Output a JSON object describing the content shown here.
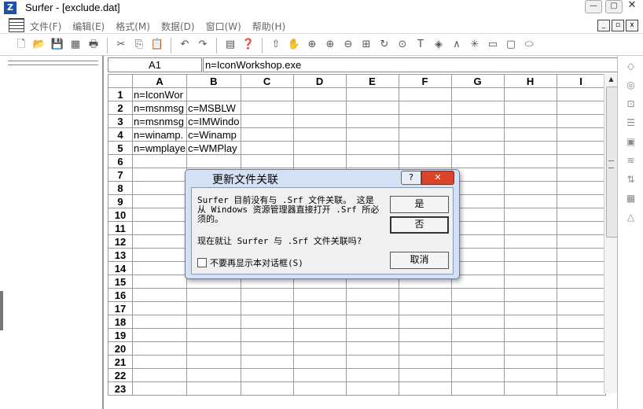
{
  "window": {
    "title": "Surfer - [exclude.dat]",
    "app_icon": "Z",
    "controls": [
      "—",
      "▢",
      "✕"
    ]
  },
  "menubar": {
    "items": [
      "文件(F)",
      "编辑(E)",
      "格式(M)",
      "数据(D)",
      "窗口(W)",
      "帮助(H)"
    ],
    "mdi_controls": [
      "_",
      "▫",
      "x"
    ]
  },
  "toolbar": {
    "icons": [
      "new-file-icon",
      "open-folder-icon",
      "save-icon",
      "worksheet-icon",
      "print-icon",
      "cut-icon",
      "copy-icon",
      "paste-icon",
      "undo-icon",
      "redo-icon",
      "object-manager-icon",
      "whats-this-icon",
      "select-arrow-icon",
      "pan-hand-icon",
      "zoom-rect-icon",
      "zoom-in-icon",
      "zoom-out-icon",
      "zoom-page-icon",
      "redraw-icon",
      "digitize-icon",
      "text-icon",
      "polygon-icon",
      "polyline-icon",
      "symbol-icon",
      "rectangle-icon",
      "rounded-rect-icon",
      "ellipse-icon"
    ],
    "glyphs": [
      "🗋",
      "📂",
      "💾",
      "▦",
      "🖶",
      "✂",
      "⎘",
      "📋",
      "↶",
      "↷",
      "▤",
      "❓",
      "⇧",
      "✋",
      "⊕",
      "⊕",
      "⊖",
      "⊞",
      "↻",
      "⊙",
      "T",
      "◈",
      "∧",
      "✳",
      "▭",
      "▢",
      "⬭"
    ]
  },
  "formula_bar": {
    "cell_ref": "A1",
    "value": "n=IconWorkshop.exe"
  },
  "sheet": {
    "columns": [
      "A",
      "B",
      "C",
      "D",
      "E",
      "F",
      "G",
      "H",
      "I"
    ],
    "rows": [
      {
        "num": "1",
        "cells": [
          "n=IconWor",
          "",
          "",
          "",
          "",
          "",
          "",
          "",
          ""
        ]
      },
      {
        "num": "2",
        "cells": [
          "n=msnmsg",
          "c=MSBLW",
          "",
          "",
          "",
          "",
          "",
          "",
          ""
        ]
      },
      {
        "num": "3",
        "cells": [
          "n=msnmsg",
          "c=IMWindo",
          "",
          "",
          "",
          "",
          "",
          "",
          ""
        ]
      },
      {
        "num": "4",
        "cells": [
          "n=winamp.",
          "c=Winamp",
          "",
          "",
          "",
          "",
          "",
          "",
          ""
        ]
      },
      {
        "num": "5",
        "cells": [
          "n=wmplaye",
          "c=WMPlay",
          "",
          "",
          "",
          "",
          "",
          "",
          ""
        ]
      },
      {
        "num": "6",
        "cells": [
          "",
          "",
          "",
          "",
          "",
          "",
          "",
          "",
          ""
        ]
      },
      {
        "num": "7",
        "cells": [
          "",
          "",
          "",
          "",
          "",
          "",
          "",
          "",
          ""
        ]
      },
      {
        "num": "8",
        "cells": [
          "",
          "",
          "",
          "",
          "",
          "",
          "",
          "",
          ""
        ]
      },
      {
        "num": "9",
        "cells": [
          "",
          "",
          "",
          "",
          "",
          "",
          "",
          "",
          ""
        ]
      },
      {
        "num": "10",
        "cells": [
          "",
          "",
          "",
          "",
          "",
          "",
          "",
          "",
          ""
        ]
      },
      {
        "num": "11",
        "cells": [
          "",
          "",
          "",
          "",
          "",
          "",
          "",
          "",
          ""
        ]
      },
      {
        "num": "12",
        "cells": [
          "",
          "",
          "",
          "",
          "",
          "",
          "",
          "",
          ""
        ]
      },
      {
        "num": "13",
        "cells": [
          "",
          "",
          "",
          "",
          "",
          "",
          "",
          "",
          ""
        ]
      },
      {
        "num": "14",
        "cells": [
          "",
          "",
          "",
          "",
          "",
          "",
          "",
          "",
          ""
        ]
      },
      {
        "num": "15",
        "cells": [
          "",
          "",
          "",
          "",
          "",
          "",
          "",
          "",
          ""
        ]
      },
      {
        "num": "16",
        "cells": [
          "",
          "",
          "",
          "",
          "",
          "",
          "",
          "",
          ""
        ]
      },
      {
        "num": "17",
        "cells": [
          "",
          "",
          "",
          "",
          "",
          "",
          "",
          "",
          ""
        ]
      },
      {
        "num": "18",
        "cells": [
          "",
          "",
          "",
          "",
          "",
          "",
          "",
          "",
          ""
        ]
      },
      {
        "num": "19",
        "cells": [
          "",
          "",
          "",
          "",
          "",
          "",
          "",
          "",
          ""
        ]
      },
      {
        "num": "20",
        "cells": [
          "",
          "",
          "",
          "",
          "",
          "",
          "",
          "",
          ""
        ]
      },
      {
        "num": "21",
        "cells": [
          "",
          "",
          "",
          "",
          "",
          "",
          "",
          "",
          ""
        ]
      },
      {
        "num": "22",
        "cells": [
          "",
          "",
          "",
          "",
          "",
          "",
          "",
          "",
          ""
        ]
      },
      {
        "num": "23",
        "cells": [
          "",
          "",
          "",
          "",
          "",
          "",
          "",
          "",
          ""
        ]
      }
    ]
  },
  "right_toolbar": {
    "icons": [
      "base-map-icon",
      "contour-map-icon",
      "post-map-icon",
      "classed-post-icon",
      "image-map-icon",
      "shaded-relief-icon",
      "vector-map-icon",
      "wireframe-icon",
      "surface-icon"
    ],
    "glyphs": [
      "◇",
      "◎",
      "⊡",
      "☰",
      "▣",
      "≋",
      "⇅",
      "▦",
      "△"
    ]
  },
  "dialog": {
    "title": "更新文件关联",
    "help_label": "?",
    "close_label": "✕",
    "message": "Surfer 目前没有与 .Srf 文件关联。 这是从 Windows 资源管理器直接打开 .Srf 所必须的。",
    "question": "现在就让 Surfer 与 .Srf 文件关联吗?",
    "checkbox_label": "不要再显示本对话框(S)",
    "yes_label": "是",
    "no_label": "否",
    "cancel_label": "取消"
  }
}
